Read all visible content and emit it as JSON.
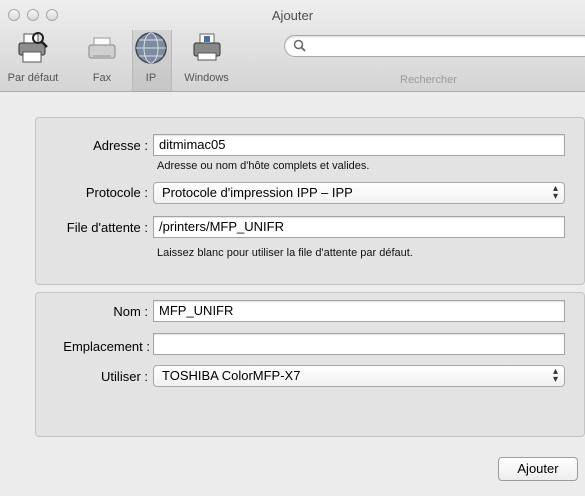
{
  "window": {
    "title": "Ajouter"
  },
  "toolbar": {
    "items": [
      {
        "label": "Par défaut",
        "icon": "printer-default-icon"
      },
      {
        "label": "Fax",
        "icon": "fax-icon"
      },
      {
        "label": "IP",
        "icon": "globe-icon",
        "selected": true
      },
      {
        "label": "Windows",
        "icon": "windows-printer-icon"
      }
    ],
    "search": {
      "placeholder": "",
      "label": "Rechercher",
      "icon": "search-icon"
    }
  },
  "network": {
    "address": {
      "label": "Adresse :",
      "value": "ditmimac05",
      "hint": "Adresse ou nom d'hôte complets et valides."
    },
    "protocol": {
      "label": "Protocole :",
      "value": "Protocole d'impression IPP – IPP"
    },
    "queue": {
      "label": "File d'attente :",
      "value": "/printers/MFP_UNIFR",
      "hint": "Laissez blanc pour utiliser la file d'attente par défaut."
    }
  },
  "printer": {
    "name": {
      "label": "Nom :",
      "value": "MFP_UNIFR"
    },
    "location": {
      "label": "Emplacement :",
      "value": ""
    },
    "driver": {
      "label": "Utiliser :",
      "value": "TOSHIBA ColorMFP-X7"
    }
  },
  "actions": {
    "add_label": "Ajouter"
  },
  "colors": {
    "window_bg": "#ececec",
    "panel_bg": "#e3e3e3"
  }
}
